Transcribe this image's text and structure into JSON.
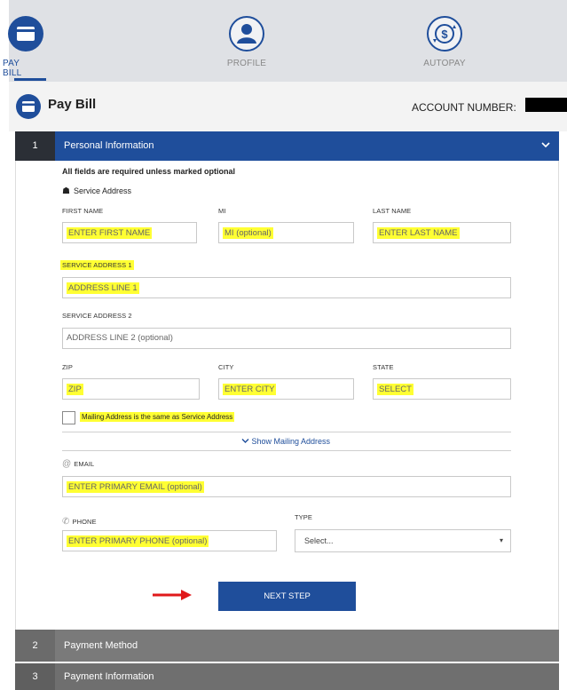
{
  "nav": {
    "items": [
      {
        "label": "PAY BILL",
        "icon": "card-icon",
        "active": true
      },
      {
        "label": "PROFILE",
        "icon": "user-icon",
        "active": false
      },
      {
        "label": "AUTOPAY",
        "icon": "autopay-dollar-icon",
        "active": false
      }
    ]
  },
  "header": {
    "title": "Pay Bill",
    "account_label": "ACCOUNT NUMBER:",
    "account_value_redacted": true
  },
  "steps": [
    {
      "number": "1",
      "title": "Personal Information",
      "expanded": true
    },
    {
      "number": "2",
      "title": "Payment Method",
      "expanded": false
    },
    {
      "number": "3",
      "title": "Payment Information",
      "expanded": false
    }
  ],
  "form": {
    "required_note": "All fields are required unless marked optional",
    "service_address_heading": "Service Address",
    "first_name": {
      "label": "FIRST NAME",
      "placeholder": "ENTER FIRST NAME"
    },
    "mi": {
      "label": "MI",
      "placeholder": "MI (optional)"
    },
    "last_name": {
      "label": "LAST NAME",
      "placeholder": "ENTER LAST NAME"
    },
    "service_address_1": {
      "label": "SERVICE ADDRESS 1",
      "placeholder": "ADDRESS LINE 1"
    },
    "service_address_2": {
      "label": "SERVICE ADDRESS 2",
      "placeholder": "ADDRESS LINE 2 (optional)"
    },
    "zip": {
      "label": "ZIP",
      "placeholder": "ZIP"
    },
    "city": {
      "label": "CITY",
      "placeholder": "ENTER CITY"
    },
    "state": {
      "label": "STATE",
      "placeholder": "SELECT"
    },
    "mailing_same": {
      "label": "Mailing Address is the same as Service Address",
      "checked": false
    },
    "show_mailing": "Show Mailing Address",
    "email": {
      "label": "EMAIL",
      "placeholder": "ENTER PRIMARY EMAIL (optional)"
    },
    "phone": {
      "label": "PHONE",
      "placeholder": "ENTER PRIMARY PHONE (optional)"
    },
    "type": {
      "label": "TYPE",
      "selected": "Select..."
    },
    "next_button": "NEXT STEP"
  },
  "colors": {
    "brand_blue": "#1f4e9b",
    "highlight": "#ffff33",
    "annotation_arrow": "#e0191b"
  }
}
